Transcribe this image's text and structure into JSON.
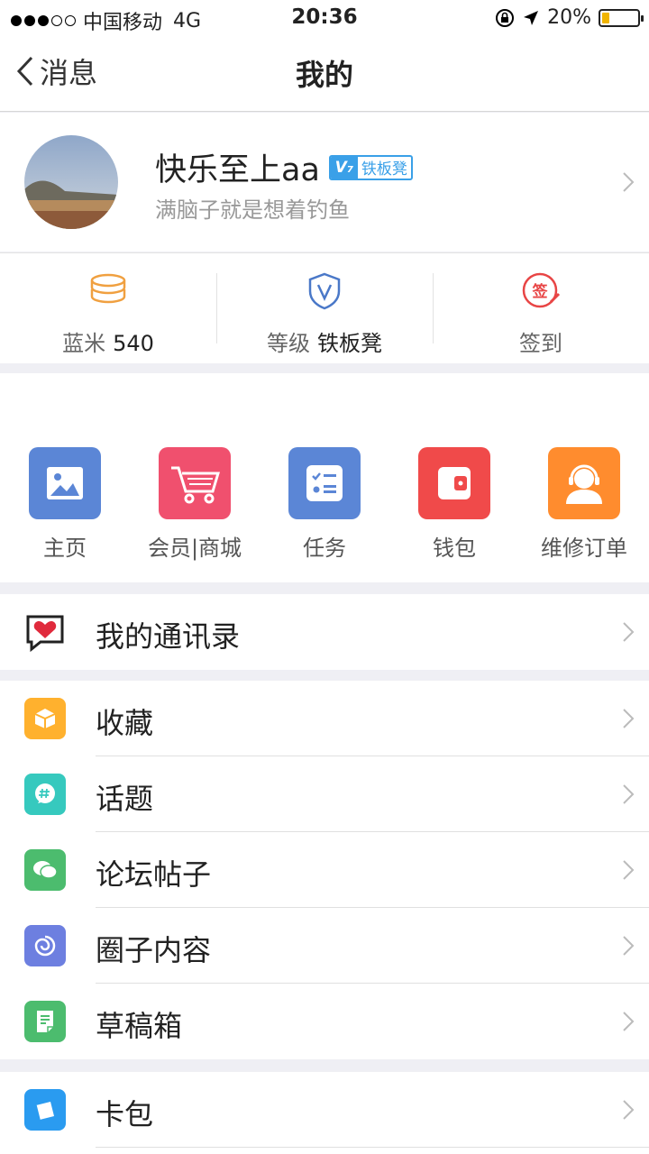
{
  "status": {
    "carrier": "中国移动",
    "network": "4G",
    "time": "20:36",
    "battery": "20%",
    "battery_level": 0.2
  },
  "nav": {
    "back_label": "消息",
    "title": "我的"
  },
  "profile": {
    "name": "快乐至上aa",
    "badge_v": "V₇",
    "badge_text": "铁板凳",
    "signature": "满脑子就是想着钓鱼"
  },
  "stats": [
    {
      "label": "蓝米",
      "value": "540",
      "icon": "coins-stack-icon"
    },
    {
      "label": "等级",
      "value": "铁板凳",
      "icon": "shield-v-icon"
    },
    {
      "label": "签到",
      "value": "",
      "icon": "sign-in-stamp-icon"
    }
  ],
  "stats_sign_glyph": "签",
  "grid": [
    {
      "label": "主页",
      "icon": "picture-icon",
      "color": "#5b86d6"
    },
    {
      "label": "会员|商城",
      "icon": "cart-icon",
      "color": "#f0506e"
    },
    {
      "label": "任务",
      "icon": "task-list-icon",
      "color": "#5b86d6"
    },
    {
      "label": "钱包",
      "icon": "wallet-icon",
      "color": "#f04a4a"
    },
    {
      "label": "维修订单",
      "icon": "support-agent-icon",
      "color": "#ff8c2e"
    }
  ],
  "lists": {
    "contacts": [
      {
        "label": "我的通讯录",
        "icon": "heart-bubble-icon"
      }
    ],
    "main": [
      {
        "label": "收藏",
        "icon": "box-icon",
        "color": "#ffb12e"
      },
      {
        "label": "话题",
        "icon": "hashtag-bubble-icon",
        "color": "#36c9be"
      },
      {
        "label": "论坛帖子",
        "icon": "chat-bubbles-icon",
        "color": "#4cbc6e"
      },
      {
        "label": "圈子内容",
        "icon": "swirl-icon",
        "color": "#6d7fe0"
      },
      {
        "label": "草稿箱",
        "icon": "draft-doc-icon",
        "color": "#4cbc6e"
      }
    ],
    "wallet": [
      {
        "label": "卡包",
        "icon": "card-pack-icon",
        "color": "#2a9bf0"
      }
    ]
  }
}
